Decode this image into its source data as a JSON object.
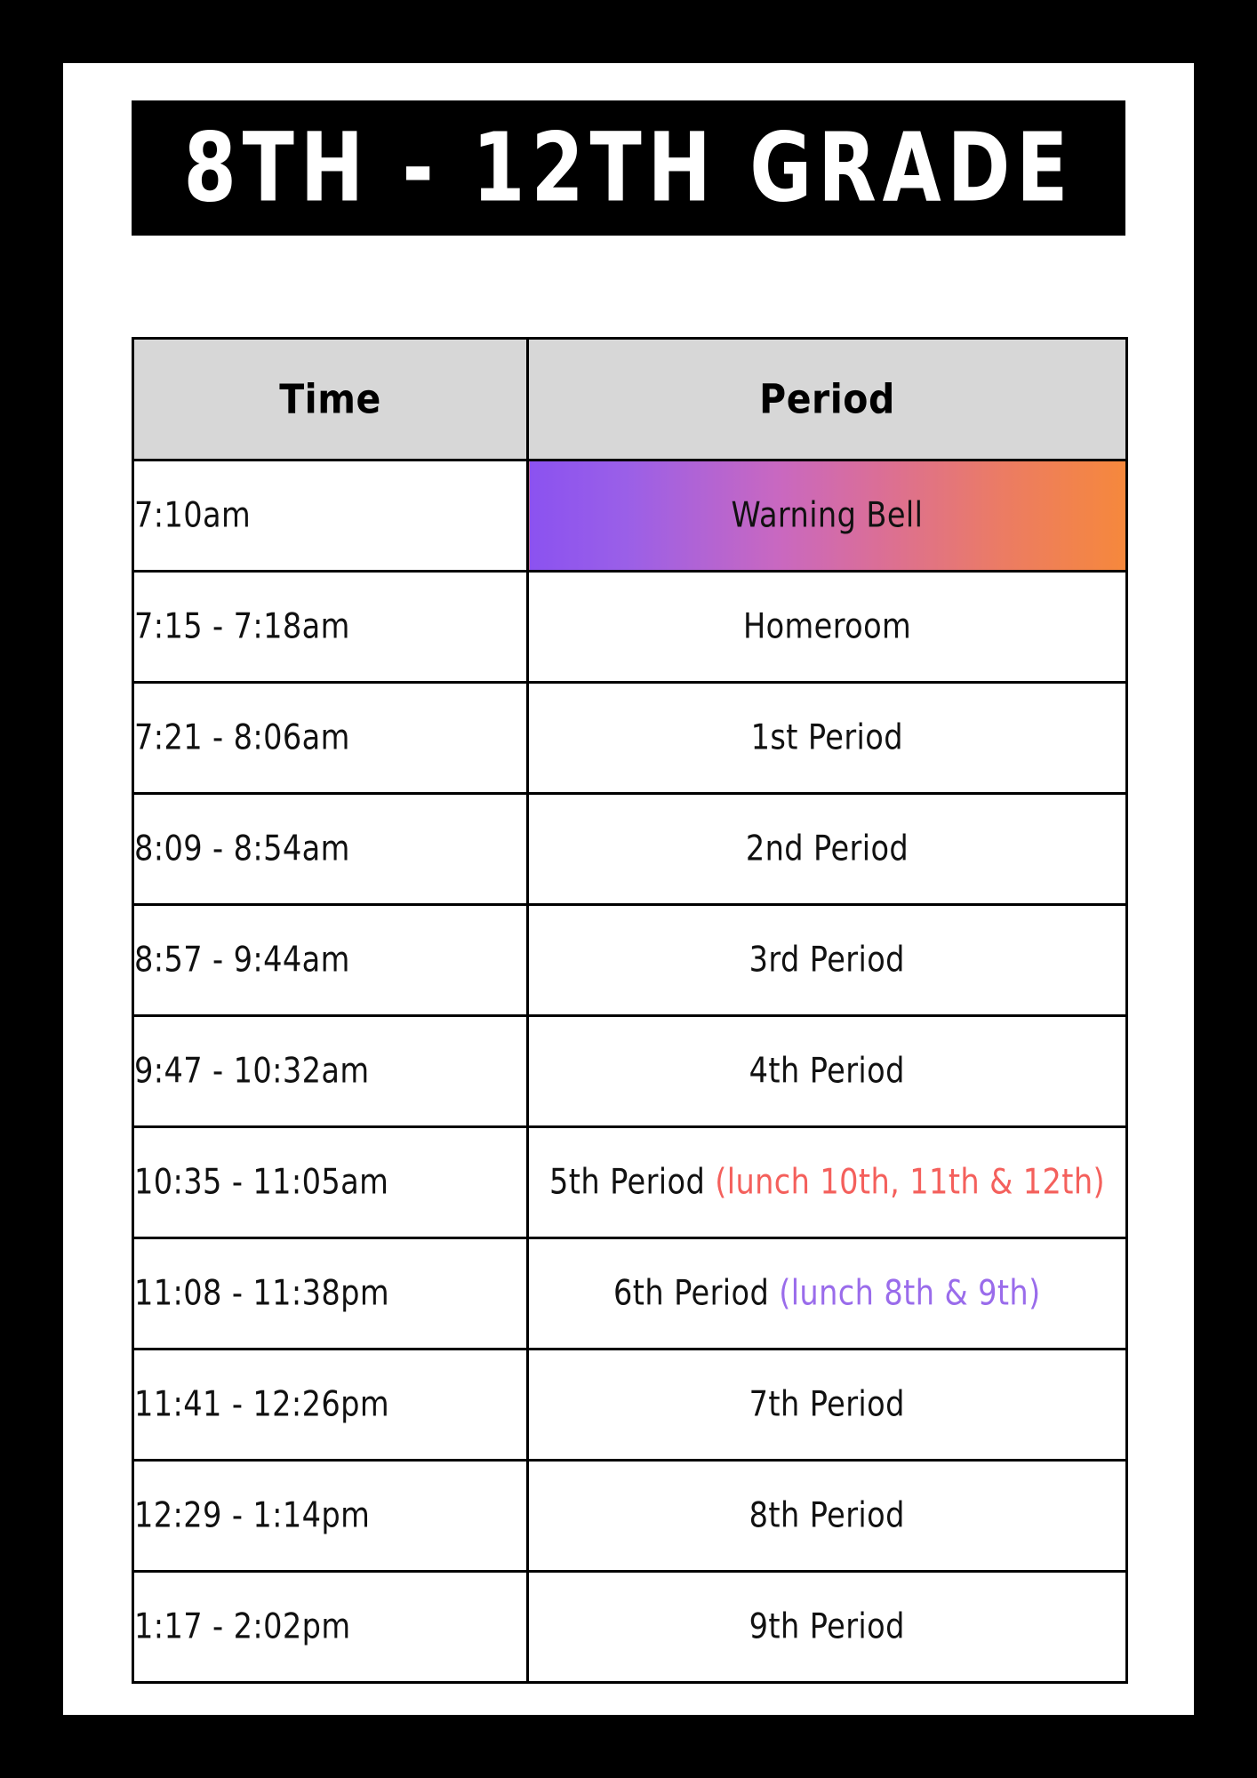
{
  "poster": {
    "title": "8TH - 12TH GRADE",
    "frame_color": "#000000",
    "page_color": "#ffffff"
  },
  "table": {
    "headers": [
      "Time",
      "Period"
    ],
    "header_bg": "#d7d7d7",
    "highlight_gradient": {
      "from": "#8b52f0",
      "mid": "#da6e98",
      "to": "#f6883c"
    },
    "lunch_colors": {
      "red": "#f4605c",
      "purple": "#9a6ceb"
    },
    "rows": [
      {
        "time": "7:10am",
        "period": "Warning Bell",
        "lunch_note": "",
        "lunch_style": "",
        "highlight": true
      },
      {
        "time": "7:15 - 7:18am",
        "period": "Homeroom",
        "lunch_note": "",
        "lunch_style": "",
        "highlight": false
      },
      {
        "time": "7:21 - 8:06am",
        "period": "1st Period",
        "lunch_note": "",
        "lunch_style": "",
        "highlight": false
      },
      {
        "time": "8:09 - 8:54am",
        "period": "2nd Period",
        "lunch_note": "",
        "lunch_style": "",
        "highlight": false
      },
      {
        "time": "8:57 - 9:44am",
        "period": "3rd Period",
        "lunch_note": "",
        "lunch_style": "",
        "highlight": false
      },
      {
        "time": "9:47 - 10:32am",
        "period": "4th Period",
        "lunch_note": "",
        "lunch_style": "",
        "highlight": false
      },
      {
        "time": "10:35 - 11:05am",
        "period": "5th Period",
        "lunch_note": "(lunch 10th, 11th & 12th)",
        "lunch_style": "lunch-red",
        "highlight": false
      },
      {
        "time": "11:08 - 11:38pm",
        "period": "6th Period",
        "lunch_note": "(lunch 8th & 9th)",
        "lunch_style": "lunch-purple",
        "highlight": false
      },
      {
        "time": "11:41 - 12:26pm",
        "period": "7th Period",
        "lunch_note": "",
        "lunch_style": "",
        "highlight": false
      },
      {
        "time": "12:29 - 1:14pm",
        "period": "8th Period",
        "lunch_note": "",
        "lunch_style": "",
        "highlight": false
      },
      {
        "time": "1:17 - 2:02pm",
        "period": "9th Period",
        "lunch_note": "",
        "lunch_style": "",
        "highlight": false
      }
    ]
  }
}
